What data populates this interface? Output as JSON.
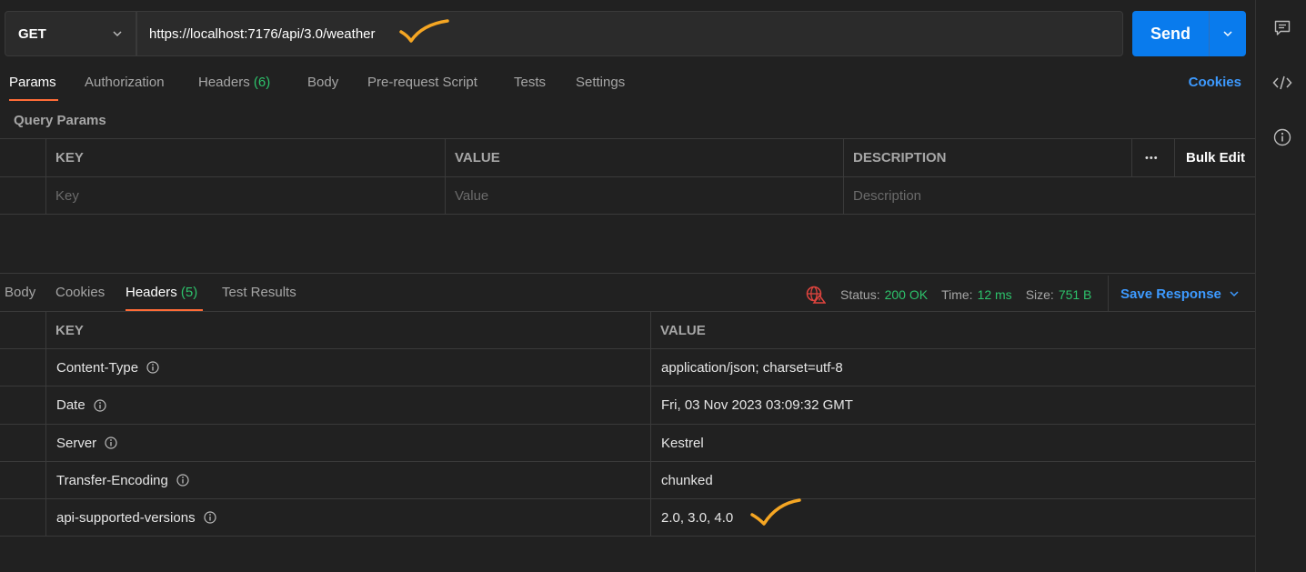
{
  "request": {
    "method": "GET",
    "url": "https://localhost:7176/api/3.0/weather",
    "send_label": "Send"
  },
  "request_tabs": [
    {
      "label": "Params",
      "count": ""
    },
    {
      "label": "Authorization",
      "count": ""
    },
    {
      "label": "Headers",
      "count": "(6)"
    },
    {
      "label": "Body",
      "count": ""
    },
    {
      "label": "Pre-request Script",
      "count": ""
    },
    {
      "label": "Tests",
      "count": ""
    },
    {
      "label": "Settings",
      "count": ""
    }
  ],
  "cookies_link": "Cookies",
  "query_params": {
    "title": "Query Params",
    "headers": {
      "key": "KEY",
      "value": "VALUE",
      "description": "DESCRIPTION",
      "more": "•••",
      "bulk_edit": "Bulk Edit"
    },
    "placeholders": {
      "key": "Key",
      "value": "Value",
      "description": "Description"
    }
  },
  "response_tabs": [
    {
      "label": "Body",
      "count": ""
    },
    {
      "label": "Cookies",
      "count": ""
    },
    {
      "label": "Headers",
      "count": "(5)"
    },
    {
      "label": "Test Results",
      "count": ""
    }
  ],
  "response_status": {
    "status_label": "Status:",
    "status_value": "200 OK",
    "time_label": "Time:",
    "time_value": "12 ms",
    "size_label": "Size:",
    "size_value": "751 B",
    "save_response": "Save Response"
  },
  "response_headers": {
    "columns": {
      "key": "KEY",
      "value": "VALUE"
    },
    "rows": [
      {
        "key": "Content-Type",
        "value": "application/json; charset=utf-8"
      },
      {
        "key": "Date",
        "value": "Fri, 03 Nov 2023 03:09:32 GMT"
      },
      {
        "key": "Server",
        "value": "Kestrel"
      },
      {
        "key": "Transfer-Encoding",
        "value": "chunked"
      },
      {
        "key": "api-supported-versions",
        "value": "2.0, 3.0, 4.0"
      }
    ]
  },
  "colors": {
    "accent": "#097bed",
    "tab_underline": "#ff6c37",
    "success": "#2dc26b",
    "link": "#3d9aff",
    "annotation": "#f5a623"
  }
}
